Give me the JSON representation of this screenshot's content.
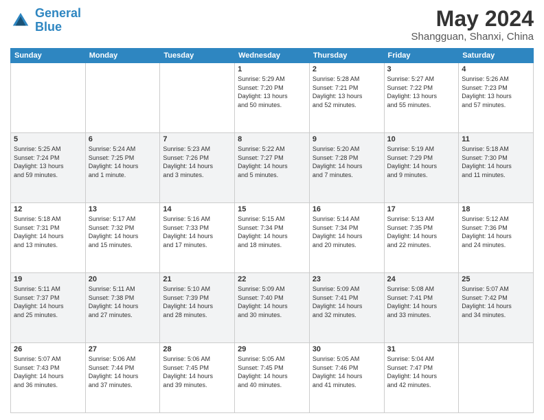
{
  "header": {
    "logo_line1": "General",
    "logo_line2": "Blue",
    "month": "May 2024",
    "location": "Shangguan, Shanxi, China"
  },
  "weekdays": [
    "Sunday",
    "Monday",
    "Tuesday",
    "Wednesday",
    "Thursday",
    "Friday",
    "Saturday"
  ],
  "weeks": [
    [
      {
        "day": "",
        "info": ""
      },
      {
        "day": "",
        "info": ""
      },
      {
        "day": "",
        "info": ""
      },
      {
        "day": "1",
        "info": "Sunrise: 5:29 AM\nSunset: 7:20 PM\nDaylight: 13 hours\nand 50 minutes."
      },
      {
        "day": "2",
        "info": "Sunrise: 5:28 AM\nSunset: 7:21 PM\nDaylight: 13 hours\nand 52 minutes."
      },
      {
        "day": "3",
        "info": "Sunrise: 5:27 AM\nSunset: 7:22 PM\nDaylight: 13 hours\nand 55 minutes."
      },
      {
        "day": "4",
        "info": "Sunrise: 5:26 AM\nSunset: 7:23 PM\nDaylight: 13 hours\nand 57 minutes."
      }
    ],
    [
      {
        "day": "5",
        "info": "Sunrise: 5:25 AM\nSunset: 7:24 PM\nDaylight: 13 hours\nand 59 minutes."
      },
      {
        "day": "6",
        "info": "Sunrise: 5:24 AM\nSunset: 7:25 PM\nDaylight: 14 hours\nand 1 minute."
      },
      {
        "day": "7",
        "info": "Sunrise: 5:23 AM\nSunset: 7:26 PM\nDaylight: 14 hours\nand 3 minutes."
      },
      {
        "day": "8",
        "info": "Sunrise: 5:22 AM\nSunset: 7:27 PM\nDaylight: 14 hours\nand 5 minutes."
      },
      {
        "day": "9",
        "info": "Sunrise: 5:20 AM\nSunset: 7:28 PM\nDaylight: 14 hours\nand 7 minutes."
      },
      {
        "day": "10",
        "info": "Sunrise: 5:19 AM\nSunset: 7:29 PM\nDaylight: 14 hours\nand 9 minutes."
      },
      {
        "day": "11",
        "info": "Sunrise: 5:18 AM\nSunset: 7:30 PM\nDaylight: 14 hours\nand 11 minutes."
      }
    ],
    [
      {
        "day": "12",
        "info": "Sunrise: 5:18 AM\nSunset: 7:31 PM\nDaylight: 14 hours\nand 13 minutes."
      },
      {
        "day": "13",
        "info": "Sunrise: 5:17 AM\nSunset: 7:32 PM\nDaylight: 14 hours\nand 15 minutes."
      },
      {
        "day": "14",
        "info": "Sunrise: 5:16 AM\nSunset: 7:33 PM\nDaylight: 14 hours\nand 17 minutes."
      },
      {
        "day": "15",
        "info": "Sunrise: 5:15 AM\nSunset: 7:34 PM\nDaylight: 14 hours\nand 18 minutes."
      },
      {
        "day": "16",
        "info": "Sunrise: 5:14 AM\nSunset: 7:34 PM\nDaylight: 14 hours\nand 20 minutes."
      },
      {
        "day": "17",
        "info": "Sunrise: 5:13 AM\nSunset: 7:35 PM\nDaylight: 14 hours\nand 22 minutes."
      },
      {
        "day": "18",
        "info": "Sunrise: 5:12 AM\nSunset: 7:36 PM\nDaylight: 14 hours\nand 24 minutes."
      }
    ],
    [
      {
        "day": "19",
        "info": "Sunrise: 5:11 AM\nSunset: 7:37 PM\nDaylight: 14 hours\nand 25 minutes."
      },
      {
        "day": "20",
        "info": "Sunrise: 5:11 AM\nSunset: 7:38 PM\nDaylight: 14 hours\nand 27 minutes."
      },
      {
        "day": "21",
        "info": "Sunrise: 5:10 AM\nSunset: 7:39 PM\nDaylight: 14 hours\nand 28 minutes."
      },
      {
        "day": "22",
        "info": "Sunrise: 5:09 AM\nSunset: 7:40 PM\nDaylight: 14 hours\nand 30 minutes."
      },
      {
        "day": "23",
        "info": "Sunrise: 5:09 AM\nSunset: 7:41 PM\nDaylight: 14 hours\nand 32 minutes."
      },
      {
        "day": "24",
        "info": "Sunrise: 5:08 AM\nSunset: 7:41 PM\nDaylight: 14 hours\nand 33 minutes."
      },
      {
        "day": "25",
        "info": "Sunrise: 5:07 AM\nSunset: 7:42 PM\nDaylight: 14 hours\nand 34 minutes."
      }
    ],
    [
      {
        "day": "26",
        "info": "Sunrise: 5:07 AM\nSunset: 7:43 PM\nDaylight: 14 hours\nand 36 minutes."
      },
      {
        "day": "27",
        "info": "Sunrise: 5:06 AM\nSunset: 7:44 PM\nDaylight: 14 hours\nand 37 minutes."
      },
      {
        "day": "28",
        "info": "Sunrise: 5:06 AM\nSunset: 7:45 PM\nDaylight: 14 hours\nand 39 minutes."
      },
      {
        "day": "29",
        "info": "Sunrise: 5:05 AM\nSunset: 7:45 PM\nDaylight: 14 hours\nand 40 minutes."
      },
      {
        "day": "30",
        "info": "Sunrise: 5:05 AM\nSunset: 7:46 PM\nDaylight: 14 hours\nand 41 minutes."
      },
      {
        "day": "31",
        "info": "Sunrise: 5:04 AM\nSunset: 7:47 PM\nDaylight: 14 hours\nand 42 minutes."
      },
      {
        "day": "",
        "info": ""
      }
    ]
  ]
}
